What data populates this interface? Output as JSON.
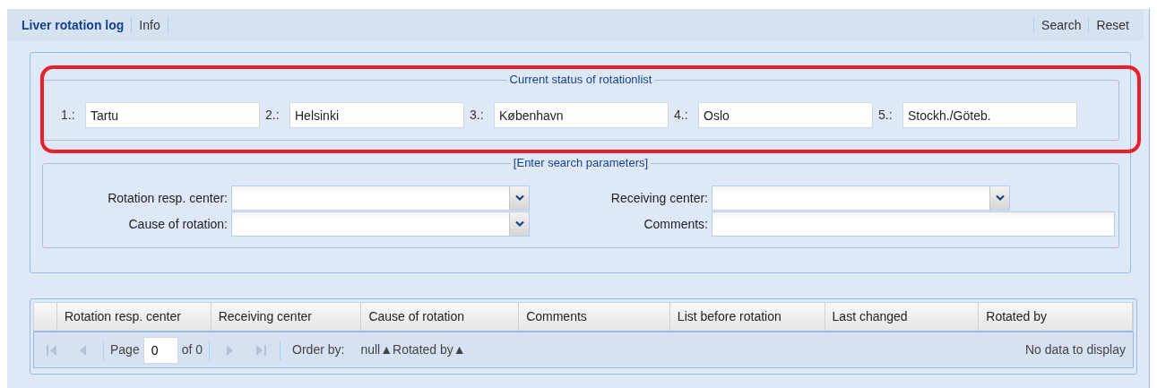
{
  "tabs": [
    {
      "label": "Liver rotation log",
      "selected": true
    },
    {
      "label": "Info",
      "selected": false
    }
  ],
  "toolbar": [
    "Search",
    "Reset"
  ],
  "status": {
    "legend": "Current status of rotationlist",
    "highlighted": true,
    "entries": [
      {
        "label": "1.:",
        "value": "Tartu"
      },
      {
        "label": "2.:",
        "value": "Helsinki"
      },
      {
        "label": "3.:",
        "value": "København"
      },
      {
        "label": "4.:",
        "value": "Oslo"
      },
      {
        "label": "5.:",
        "value": "Stockh./Göteb."
      }
    ]
  },
  "search": {
    "legend": "[Enter search parameters]",
    "fields": [
      {
        "label": "Rotation resp. center:",
        "kind": "combo"
      },
      {
        "label": "Receiving center:",
        "kind": "combo"
      },
      {
        "label": "Cause of rotation:",
        "kind": "combo"
      },
      {
        "label": "Comments:",
        "kind": "text"
      }
    ]
  },
  "grid": {
    "columns": [
      "Rotation resp. center",
      "Receiving center",
      "Cause of rotation",
      "Comments",
      "List before rotation",
      "Last changed",
      "Rotated by"
    ],
    "pager": {
      "buttons": [
        {
          "kind": "first",
          "disabled": true
        },
        {
          "kind": "prev",
          "disabled": true
        },
        {
          "kind": "next",
          "disabled": true
        },
        {
          "kind": "last",
          "disabled": true
        }
      ],
      "page_label": "Page",
      "page_value": "0",
      "of_text": "of 0",
      "order_label": "Order by:",
      "order_value": "null▲Rotated by▲",
      "empty_text": "No data to display"
    }
  }
}
